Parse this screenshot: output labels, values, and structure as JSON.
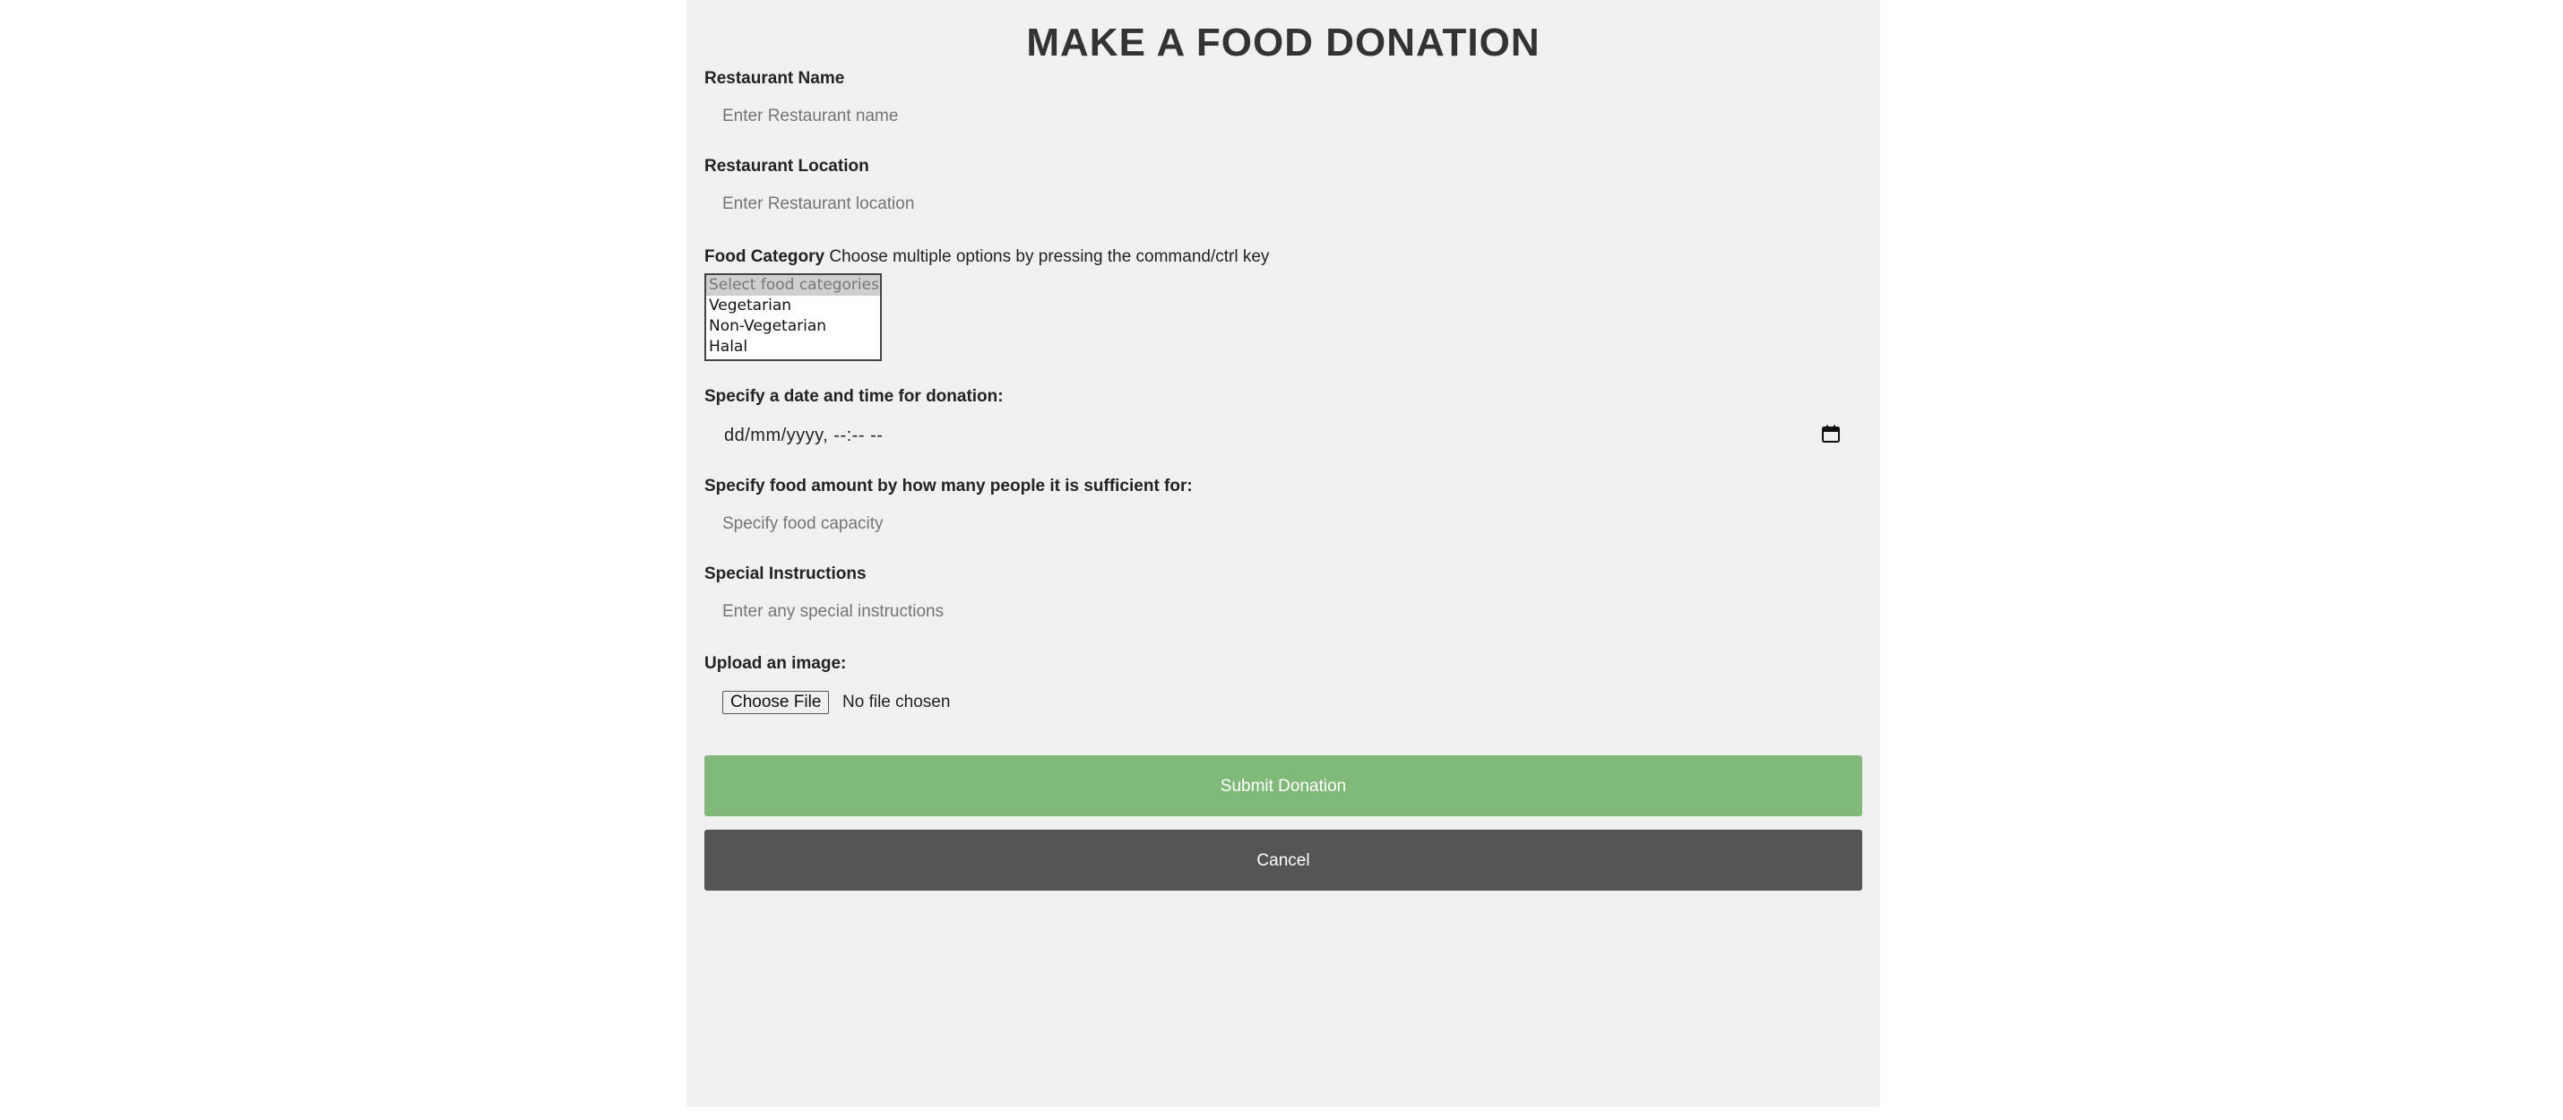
{
  "page": {
    "title": "MAKE A FOOD DONATION"
  },
  "colors": {
    "panel_bg": "#f0f0f0",
    "submit_bg": "#80ba78",
    "cancel_bg": "#555555"
  },
  "form": {
    "restaurant_name": {
      "label": "Restaurant Name",
      "placeholder": "Enter Restaurant name",
      "value": ""
    },
    "restaurant_location": {
      "label": "Restaurant Location",
      "placeholder": "Enter Restaurant location",
      "value": ""
    },
    "food_category": {
      "label": "Food Category",
      "hint": "Choose multiple options by pressing the command/ctrl key",
      "options": [
        "Select food categories",
        "Vegetarian",
        "Non-Vegetarian",
        "Halal"
      ]
    },
    "donation_datetime": {
      "label": "Specify a date and time for donation:",
      "display": "dd/mm/yyyy, --:-- --",
      "icon": "calendar-icon"
    },
    "food_capacity": {
      "label": "Specify food amount by how many people it is sufficient for:",
      "placeholder": "Specify food capacity",
      "value": ""
    },
    "special_instructions": {
      "label": "Special Instructions",
      "placeholder": "Enter any special instructions",
      "value": ""
    },
    "image_upload": {
      "label": "Upload an image:",
      "button_label": "Choose File",
      "status": "No file chosen"
    },
    "submit_label": "Submit Donation",
    "cancel_label": "Cancel"
  }
}
